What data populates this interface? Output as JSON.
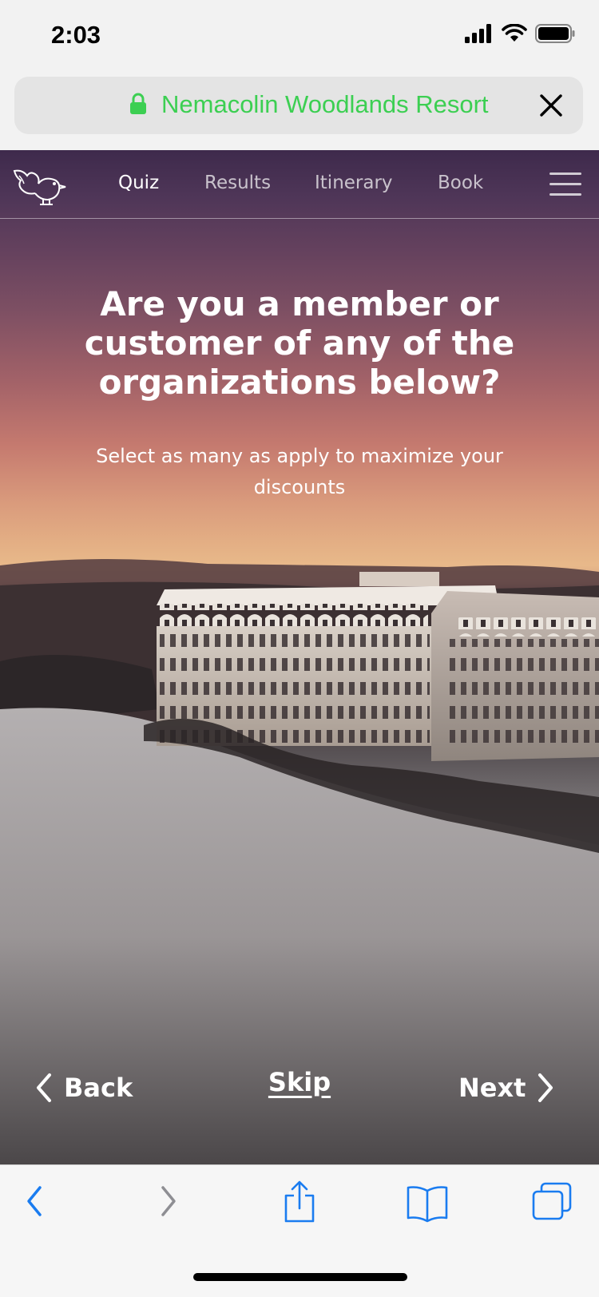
{
  "status_bar": {
    "time": "2:03"
  },
  "url_bar": {
    "title": "Nemacolin Woodlands Resort",
    "title_color": "#3ccf52"
  },
  "nav": {
    "tabs": [
      {
        "label": "Quiz",
        "active": true
      },
      {
        "label": "Results",
        "active": false
      },
      {
        "label": "Itinerary",
        "active": false
      },
      {
        "label": "Book",
        "active": false
      }
    ]
  },
  "quiz": {
    "question": "Are you a member or customer of any of the organizations below?",
    "subtitle": "Select as many as apply to maximize your discounts",
    "back_label": "Back",
    "skip_label": "Skip",
    "next_label": "Next"
  },
  "toolbar": {
    "icons": [
      "back-arrow-icon",
      "forward-arrow-icon",
      "share-icon",
      "bookmarks-icon",
      "tabs-icon"
    ],
    "accent_color": "#1a7cf0"
  }
}
